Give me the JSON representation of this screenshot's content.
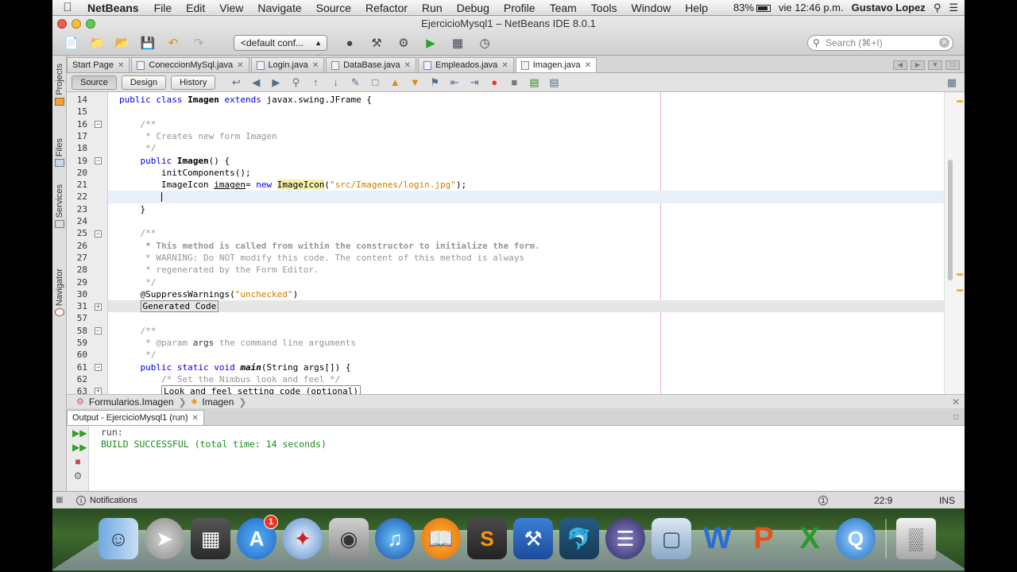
{
  "menubar": {
    "apple": "",
    "app_name": "NetBeans",
    "items": [
      "File",
      "Edit",
      "View",
      "Navigate",
      "Source",
      "Refactor",
      "Run",
      "Debug",
      "Profile",
      "Team",
      "Tools",
      "Window",
      "Help"
    ],
    "battery": "83%",
    "clock": "vie 12:46 p.m.",
    "user": "Gustavo Lopez"
  },
  "window": {
    "title": "EjercicioMysql1 – NetBeans IDE 8.0.1",
    "config_select": "<default conf...",
    "search_placeholder": "Search (⌘+I)"
  },
  "side_tabs": [
    "Projects",
    "Files",
    "Services",
    "Navigator"
  ],
  "tabs": [
    {
      "label": "Start Page",
      "active": false
    },
    {
      "label": "ConeccionMySql.java",
      "active": false
    },
    {
      "label": "Login.java",
      "active": false
    },
    {
      "label": "DataBase.java",
      "active": false
    },
    {
      "label": "Empleados.java",
      "active": false
    },
    {
      "label": "Imagen.java",
      "active": true
    }
  ],
  "editor_toolbar": {
    "source": "Source",
    "design": "Design",
    "history": "History"
  },
  "code": {
    "line_numbers": [
      "14",
      "15",
      "16",
      "17",
      "18",
      "19",
      "20",
      "21",
      "22",
      "23",
      "24",
      "25",
      "26",
      "27",
      "28",
      "29",
      "30",
      "31",
      "57",
      "58",
      "59",
      "60",
      "61",
      "62",
      "63"
    ],
    "generated_code": "Generated Code",
    "look_and_feel": "Look and feel setting code (optional)"
  },
  "breadcrumb": {
    "package": "Formularios.Imagen",
    "class": "Imagen"
  },
  "output": {
    "tab_label": "Output - EjercicioMysql1 (run)",
    "lines": [
      "run:",
      "BUILD SUCCESSFUL (total time: 14 seconds)"
    ]
  },
  "statusbar": {
    "notifications": "Notifications",
    "position": "22:9",
    "mode": "INS"
  },
  "dock": {
    "app_store_badge": "1",
    "items": [
      "finder-icon",
      "launchpad-icon",
      "photo-booth-icon",
      "app-store-icon",
      "safari-icon",
      "facetime-icon",
      "itunes-icon",
      "ibooks-icon",
      "sublime-icon",
      "xcode-icon",
      "mysql-workbench-icon",
      "eclipse-icon",
      "virtualbox-icon",
      "word-icon",
      "powerpoint-icon",
      "excel-icon",
      "quicktime-icon",
      "trash-icon"
    ]
  },
  "colors": {
    "keyword": "#0000e6",
    "comment": "#969696",
    "string": "#ce7b00",
    "build_success": "#1c8a1c"
  }
}
